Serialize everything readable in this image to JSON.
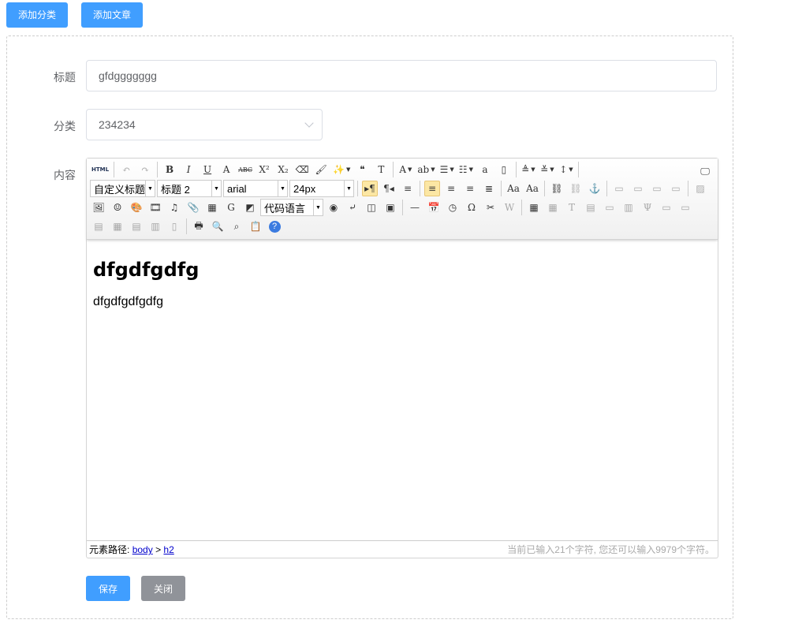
{
  "top": {
    "add_category": "添加分类",
    "add_article": "添加文章"
  },
  "form": {
    "title_label": "标题",
    "title_value": "gfdggggggg",
    "category_label": "分类",
    "category_value": "234234",
    "content_label": "内容"
  },
  "editor": {
    "combos": {
      "customstyle": "自定义标题",
      "paragraph": "标题 2",
      "fontfamily": "arial",
      "fontsize": "24px",
      "insertcode": "代码语言"
    },
    "rows": [
      [
        [
          "source",
          "HTML"
        ],
        "|",
        [
          "undo",
          "↶",
          0,
          1
        ],
        [
          "redo",
          "↷",
          0,
          1
        ],
        "|",
        [
          "bold",
          "B"
        ],
        [
          "italic",
          "I"
        ],
        [
          "underline",
          "U"
        ],
        [
          "fontborder",
          "A"
        ],
        [
          "strikethrough",
          "ABC"
        ],
        [
          "superscript",
          "X²"
        ],
        [
          "subscript",
          "X₂"
        ],
        [
          "removeformat",
          "⌫"
        ],
        [
          "formatmatch",
          "🖌"
        ],
        [
          "autotypeset",
          "✨",
          1
        ],
        [
          "blockquote",
          "❝"
        ],
        [
          "pasteplain",
          "T"
        ],
        "|",
        [
          "forecolor",
          "A",
          1
        ],
        [
          "backcolor",
          "ab",
          1
        ],
        [
          "insertorderedlist",
          "☰",
          1
        ],
        [
          "insertunorderedlist",
          "☷",
          1
        ],
        [
          "selectall",
          "a"
        ],
        [
          "cleardoc",
          "▯"
        ],
        "|",
        [
          "rowspacingtop",
          "≜",
          1
        ],
        [
          "rowspacingbottom",
          "≚",
          1
        ],
        [
          "lineheight",
          "↕",
          1
        ],
        "|"
      ],
      [
        {
          "combo": "customstyle",
          "w": 83
        },
        {
          "combo": "paragraph",
          "w": 82
        },
        {
          "combo": "fontfamily",
          "w": 82
        },
        {
          "combo": "fontsize",
          "w": 82
        },
        "|",
        [
          "directionalityltr",
          "▸¶",
          0,
          0,
          1
        ],
        [
          "directionalityrtl",
          "¶◂"
        ],
        [
          "indent",
          "≡"
        ],
        "|",
        [
          "justifyleft",
          "≡",
          0,
          0,
          1
        ],
        [
          "justifycenter",
          "≡"
        ],
        [
          "justifyright",
          "≡"
        ],
        [
          "justifyjustify",
          "≣"
        ],
        "|",
        [
          "touppercase",
          "Aa"
        ],
        [
          "tolowercase",
          "Aa"
        ],
        "|",
        [
          "link",
          "⛓"
        ],
        [
          "unlink",
          "⛓",
          0,
          1
        ],
        [
          "anchor",
          "⚓"
        ],
        "|",
        [
          "imagenone",
          "▭",
          0,
          1
        ],
        [
          "imageleft",
          "▭",
          0,
          1
        ],
        [
          "imageright",
          "▭",
          0,
          1
        ],
        [
          "imagecenter",
          "▭",
          0,
          1
        ],
        "|",
        [
          "simpleupload",
          "▨",
          0,
          1
        ]
      ],
      [
        [
          "insertimage",
          "🖼"
        ],
        [
          "emotion",
          "☺"
        ],
        [
          "scrawl",
          "🎨"
        ],
        [
          "insertvideo",
          "🎞"
        ],
        [
          "music",
          "♫"
        ],
        [
          "attachment",
          "📎"
        ],
        [
          "map",
          "▦"
        ],
        [
          "gmap",
          "G"
        ],
        [
          "insertframe",
          "◩"
        ],
        {
          "combo": "insertcode",
          "w": 80
        },
        [
          "webapp",
          "◉"
        ],
        [
          "pagebreak",
          "⤶"
        ],
        [
          "template",
          "◫"
        ],
        [
          "background",
          "▣"
        ],
        "|",
        [
          "horizontal",
          "—"
        ],
        [
          "date",
          "📅"
        ],
        [
          "time",
          "◷"
        ],
        [
          "spechars",
          "Ω"
        ],
        [
          "snapscreen",
          "✂"
        ],
        [
          "wordimage",
          "W",
          0,
          1
        ],
        "|",
        [
          "inserttable",
          "▦"
        ],
        [
          "deletetable",
          "▦",
          0,
          1
        ],
        [
          "insertparagraphbeforetable",
          "T",
          0,
          1
        ],
        [
          "insertrow",
          "▤",
          0,
          1
        ],
        [
          "deleterow",
          "▭",
          0,
          1
        ],
        [
          "insertcol",
          "▥",
          0,
          1
        ],
        [
          "deletecol",
          "Ψ",
          0,
          1
        ],
        [
          "mergecells",
          "▭",
          0,
          1
        ],
        [
          "mergeright",
          "▭",
          0,
          1
        ]
      ],
      [
        [
          "mergedown",
          "▤",
          0,
          1
        ],
        [
          "splittocells",
          "▦",
          0,
          1
        ],
        [
          "splittorows",
          "▤",
          0,
          1
        ],
        [
          "splittocols",
          "▥",
          0,
          1
        ],
        [
          "charts",
          "▯",
          0,
          1
        ],
        "|",
        [
          "print",
          "🖶"
        ],
        [
          "preview",
          "🔍"
        ],
        [
          "searchreplace",
          "⌕"
        ],
        [
          "drafts",
          "📋"
        ],
        [
          "help",
          "?"
        ]
      ]
    ],
    "fullscreen_icon": "🖵",
    "content_heading": "dfgdfgdfg",
    "content_paragraph": "dfgdfgdfgdfg",
    "path_label": "元素路径:",
    "path_body": "body",
    "path_sep": ">",
    "path_h2": "h2",
    "word_count": "当前已输入21个字符, 您还可以输入9979个字符。"
  },
  "actions": {
    "save": "保存",
    "close": "关闭"
  },
  "colors": {
    "primary": "#409eff",
    "secondary": "#909399"
  }
}
